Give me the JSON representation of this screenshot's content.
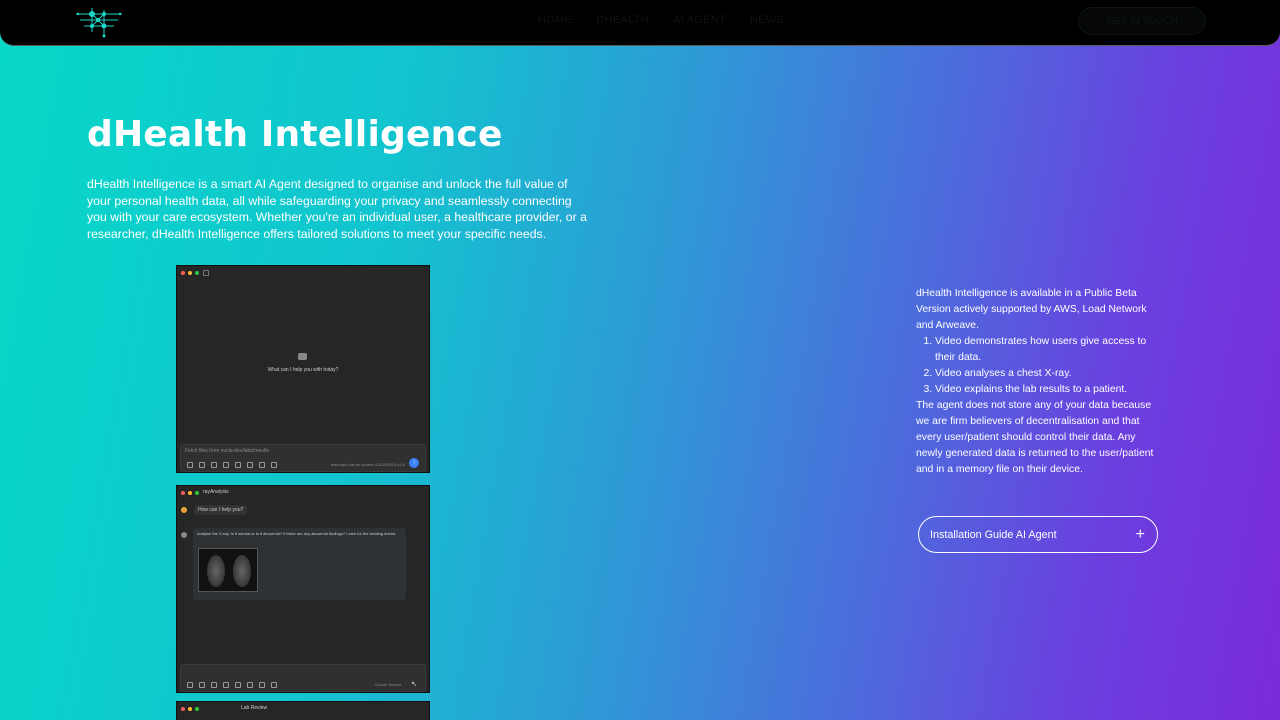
{
  "nav": {
    "items": [
      {
        "label": "HOME"
      },
      {
        "label": "DHEALTH"
      },
      {
        "label": "AI AGENT"
      },
      {
        "label": "NEWS"
      }
    ],
    "cta_label": "GET IN TOUCH"
  },
  "hero": {
    "title": "dHealth Intelligence",
    "intro": "dHealth Intelligence is a smart AI Agent designed to organise and unlock the full value of your personal health data, all while safeguarding your privacy and seamlessly connecting you with your care ecosystem. Whether you're an individual user, a healthcare provider, or a researcher, dHealth Intelligence offers tailored solutions to meet your specific needs."
  },
  "screenshots": {
    "shot1": {
      "prompt": "What can I help you with today?",
      "input_text": "Fetch files from nuvia-dev/labs/results",
      "model": "anthropic.claude-sonnet-4-20250514-v1:0"
    },
    "shot2": {
      "title": "rayAnalysis",
      "greeting": "How can I help you?",
      "user_message": "Analyse the X-ray. Is it normal or Is it abnormal? If there are any abnormal findings? I care for the treating doctor.",
      "model": "Claude Sonnet"
    },
    "shot3": {
      "title": "Lab Review"
    }
  },
  "side": {
    "intro": "dHealth Intelligence is available in a Public Beta Version actively supported by AWS, Load Network and Arweave.",
    "list": [
      "Video demonstrates how users give access to their data.",
      "Video analyses a chest X-ray.",
      "Video explains the lab results to a patient."
    ],
    "privacy": "The agent does not store any of your data because we are firm believers of decentralisation and that every user/patient should control their data. Any newly generated data is returned to the user/patient and in a memory file on their device."
  },
  "guide_button": {
    "label": "Installation Guide AI Agent",
    "icon": "plus-icon"
  },
  "colors": {
    "gradient_start": "#08d8c8",
    "gradient_end": "#7a2ad8",
    "topbar": "#000000"
  }
}
